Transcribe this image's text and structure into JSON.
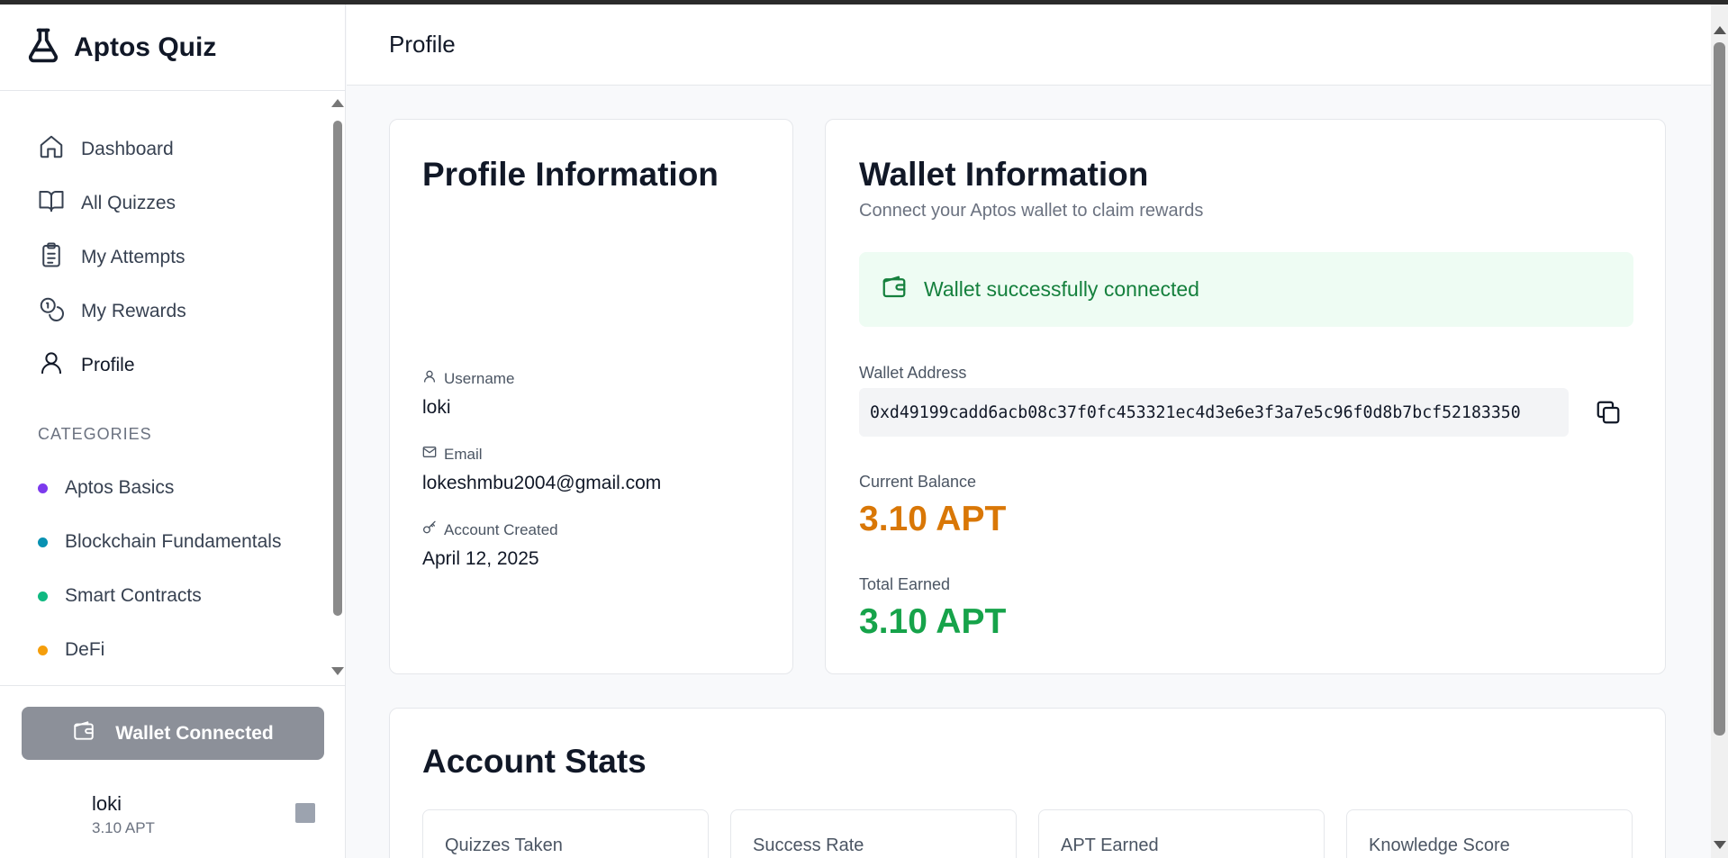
{
  "app": {
    "title": "Aptos Quiz"
  },
  "header": {
    "title": "Profile"
  },
  "sidebar": {
    "nav": [
      {
        "label": "Dashboard",
        "icon": "home-icon"
      },
      {
        "label": "All Quizzes",
        "icon": "book-open-icon"
      },
      {
        "label": "My Attempts",
        "icon": "clipboard-list-icon"
      },
      {
        "label": "My Rewards",
        "icon": "coins-icon"
      },
      {
        "label": "Profile",
        "icon": "user-icon",
        "active": true
      }
    ],
    "categories_heading": "CATEGORIES",
    "categories": [
      {
        "label": "Aptos Basics",
        "color": "#7c3aed"
      },
      {
        "label": "Blockchain Fundamentals",
        "color": "#0891b2"
      },
      {
        "label": "Smart Contracts",
        "color": "#10b981"
      },
      {
        "label": "DeFi",
        "color": "#f59e0b"
      }
    ],
    "wallet_button": "Wallet Connected",
    "user": {
      "name": "loki",
      "balance": "3.10 APT"
    }
  },
  "profile": {
    "title": "Profile Information",
    "username_label": "Username",
    "username": "loki",
    "email_label": "Email",
    "email": "lokeshmbu2004@gmail.com",
    "created_label": "Account Created",
    "created": "April 12, 2025"
  },
  "wallet": {
    "title": "Wallet Information",
    "subtitle": "Connect your Aptos wallet to claim rewards",
    "status": "Wallet successfully connected",
    "address_label": "Wallet Address",
    "address": "0xd49199cadd6acb08c37f0fc453321ec4d3e6e3f3a7e5c96f0d8b7bcf52183350",
    "balance_label": "Current Balance",
    "balance": "3.10 APT",
    "earned_label": "Total Earned",
    "earned": "3.10 APT",
    "colors": {
      "balance": "#d97706",
      "earned": "#16a34a",
      "success_bg": "#eefcf3",
      "success_text": "#15803d"
    }
  },
  "stats": {
    "title": "Account Stats",
    "items": [
      "Quizzes Taken",
      "Success Rate",
      "APT Earned",
      "Knowledge Score"
    ]
  }
}
